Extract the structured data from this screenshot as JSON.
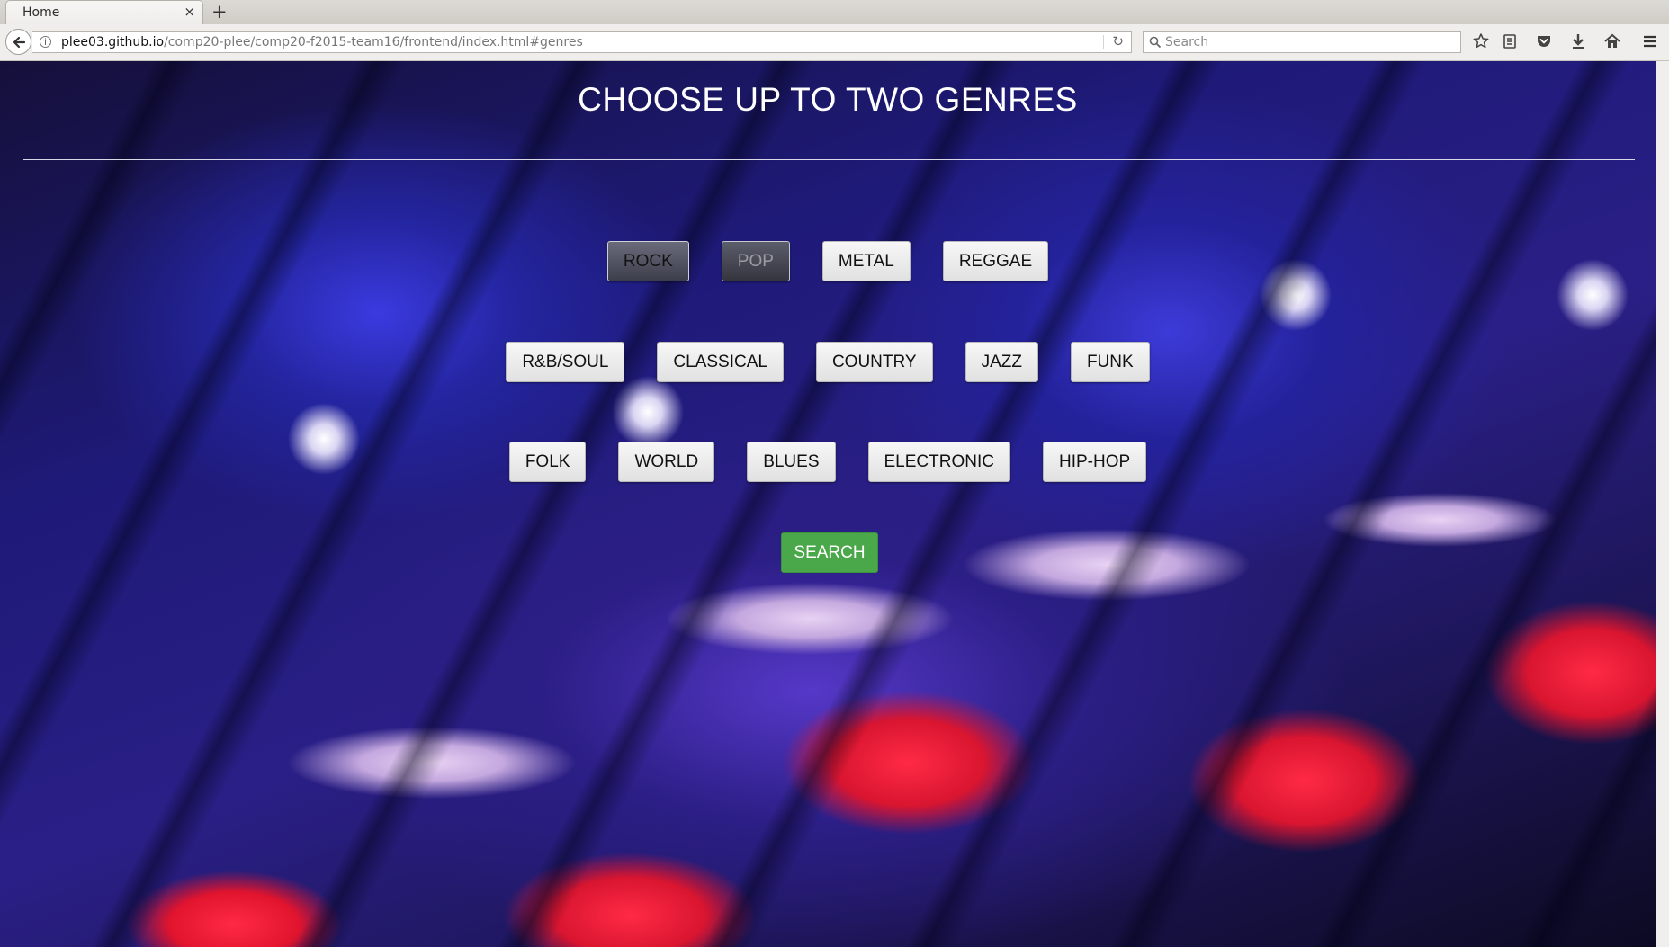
{
  "browser": {
    "tab_title": "Home",
    "close_glyph": "×",
    "new_tab_glyph": "+",
    "url_host": "plee03.github.io",
    "url_path": "/comp20-plee/comp20-f2015-team16/frontend/index.html#genres",
    "search_placeholder": "Search"
  },
  "page": {
    "heading": "CHOOSE UP TO TWO GENRES",
    "rows": [
      [
        {
          "label": "ROCK",
          "state": "selected"
        },
        {
          "label": "POP",
          "state": "selected-faded"
        },
        {
          "label": "METAL",
          "state": "normal"
        },
        {
          "label": "REGGAE",
          "state": "normal"
        }
      ],
      [
        {
          "label": "R&B/SOUL",
          "state": "normal"
        },
        {
          "label": "CLASSICAL",
          "state": "normal"
        },
        {
          "label": "COUNTRY",
          "state": "normal"
        },
        {
          "label": "JAZZ",
          "state": "normal"
        },
        {
          "label": "FUNK",
          "state": "normal"
        }
      ],
      [
        {
          "label": "FOLK",
          "state": "normal"
        },
        {
          "label": "WORLD",
          "state": "normal"
        },
        {
          "label": "BLUES",
          "state": "normal"
        },
        {
          "label": "ELECTRONIC",
          "state": "normal"
        },
        {
          "label": "HIP-HOP",
          "state": "normal"
        }
      ]
    ],
    "search_button": "SEARCH"
  },
  "colors": {
    "search_green": "#4aa84a",
    "selected_button": "#4d4e5c"
  }
}
